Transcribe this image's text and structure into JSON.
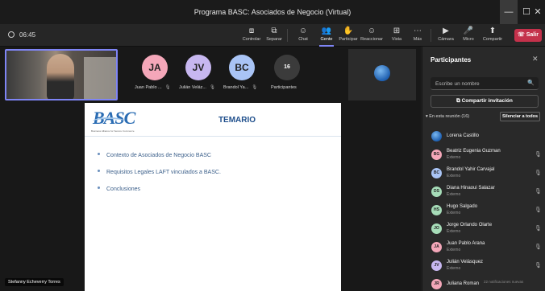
{
  "window": {
    "title": "Programa BASC: Asociados de Negocio (Virtual)"
  },
  "toolbar": {
    "timer": "06:45",
    "buttons": [
      {
        "label": "Controlar",
        "icon": "⧈"
      },
      {
        "label": "Separar",
        "icon": "⧉"
      },
      {
        "label": "Chat",
        "icon": "☺"
      },
      {
        "label": "Gente",
        "icon": "👥"
      },
      {
        "label": "Participar",
        "icon": "✋"
      },
      {
        "label": "Reaccionar",
        "icon": "☺"
      },
      {
        "label": "Vista",
        "icon": "⊞"
      },
      {
        "label": "Más",
        "icon": "⋯"
      },
      {
        "label": "Cámara",
        "icon": "▶"
      },
      {
        "label": "Micro",
        "icon": "🎤"
      },
      {
        "label": "Compartir",
        "icon": "⬆"
      }
    ],
    "leave_label": "Salir",
    "leave_color": "#c4314b",
    "accent_color": "#7f85f5"
  },
  "stage": {
    "top_participants": [
      {
        "initials": "JA",
        "name": "Juan Pablo ...",
        "color": "#f4a7b9"
      },
      {
        "initials": "JV",
        "name": "Julián Veláz...",
        "color": "#c7b7f0"
      },
      {
        "initials": "BC",
        "name": "Brandol Ya...",
        "color": "#a9c4f5"
      }
    ],
    "participant_count": "16",
    "participant_count_label": "Participantes",
    "speaker_name": "Stefanny Echeverry Torres"
  },
  "slide": {
    "logo": "BASC",
    "logo_tagline": "Business Alliance for Secure Commerce",
    "title": "TEMARIO",
    "bullets": [
      "Contexto de Asociados de Negocio BASC",
      "Requisitos Legales LAFT vinculados a BASC.",
      "Conclusiones"
    ]
  },
  "panel": {
    "title": "Participantes",
    "search_placeholder": "Escribe un nombre",
    "invite_label": "Compartir invitación",
    "section_label": "En esta reunión (16)",
    "mute_all_label": "Silenciar a todos",
    "participants": [
      {
        "initials": "",
        "name": "Lorena Castillo",
        "sub": "",
        "color": "#2f6fd1",
        "logo": true
      },
      {
        "initials": "BG",
        "name": "Beatriz Eugenia Guzman",
        "sub": "Externo",
        "color": "#f4a7b9"
      },
      {
        "initials": "BC",
        "name": "Brandol Yahir Carvajal",
        "sub": "Externo",
        "color": "#a9c4f5"
      },
      {
        "initials": "DS",
        "name": "Diana Hinaoui Salazar",
        "sub": "Externo",
        "color": "#a6dcb8"
      },
      {
        "initials": "HS",
        "name": "Hugo Salgado",
        "sub": "Externo",
        "color": "#a6dcb8"
      },
      {
        "initials": "JO",
        "name": "Jorge Orlando Olarte",
        "sub": "Externo",
        "color": "#a6dcb8"
      },
      {
        "initials": "JA",
        "name": "Juan Pablo Arana",
        "sub": "Externo",
        "color": "#f4a7b9"
      },
      {
        "initials": "JV",
        "name": "Julián Velásquez",
        "sub": "Externo",
        "color": "#c7b7f0"
      },
      {
        "initials": "JR",
        "name": "Juliana Roman",
        "sub": "",
        "color": "#f4a7b9"
      }
    ],
    "notifications_text": "22 notificaciones nuevas"
  }
}
